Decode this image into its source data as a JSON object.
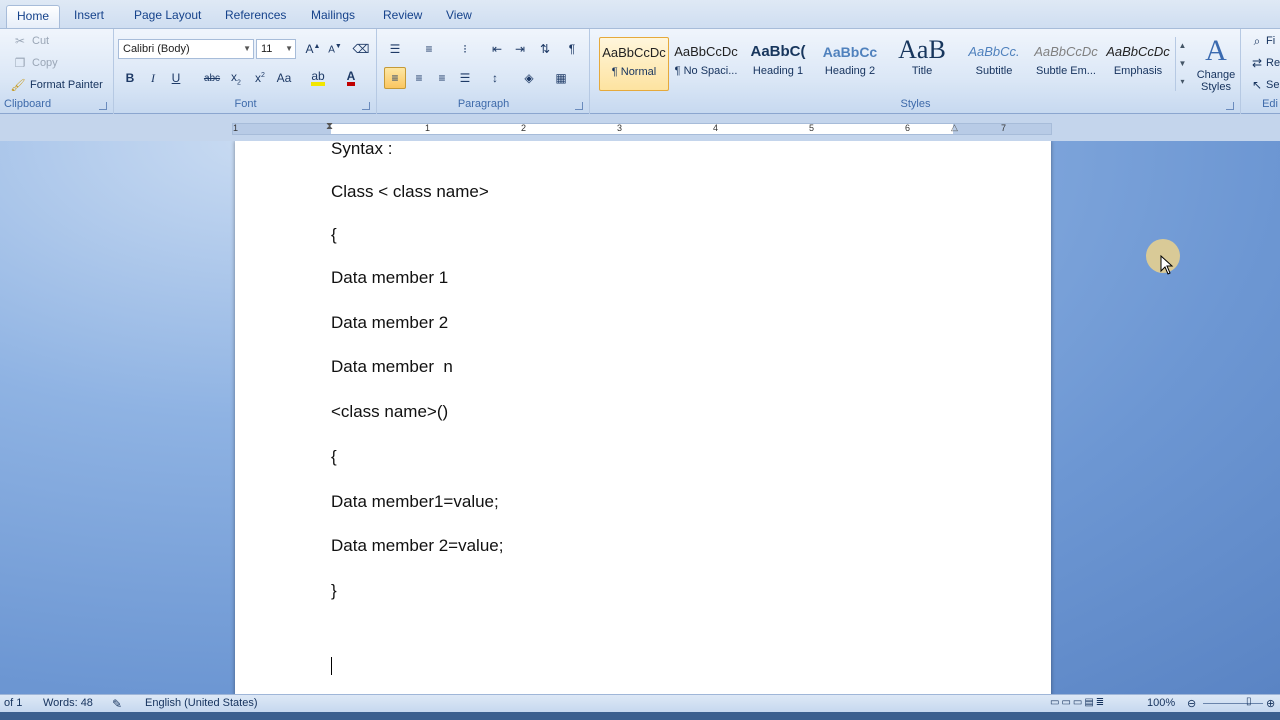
{
  "tabs": [
    "Home",
    "Insert",
    "Page Layout",
    "References",
    "Mailings",
    "Review",
    "View"
  ],
  "clipboard": {
    "cut": "Cut",
    "copy": "Copy",
    "format_painter": "Format Painter",
    "label": "Clipboard"
  },
  "font": {
    "family": "Calibri (Body)",
    "size": "11",
    "label": "Font"
  },
  "paragraph": {
    "label": "Paragraph"
  },
  "styles": {
    "label": "Styles",
    "items": [
      {
        "preview": "AaBbCcDc",
        "name": "¶ Normal"
      },
      {
        "preview": "AaBbCcDc",
        "name": "¶ No Spaci..."
      },
      {
        "preview": "AaBbC(",
        "name": "Heading 1"
      },
      {
        "preview": "AaBbCc",
        "name": "Heading 2"
      },
      {
        "preview": "AaB",
        "name": "Title"
      },
      {
        "preview": "AaBbCc.",
        "name": "Subtitle"
      },
      {
        "preview": "AaBbCcDc",
        "name": "Subtle Em..."
      },
      {
        "preview": "AaBbCcDc",
        "name": "Emphasis"
      }
    ],
    "change_styles": "Change Styles"
  },
  "editing": {
    "find": "Fi",
    "replace": "Re",
    "select": "Se",
    "label": "Edi"
  },
  "ruler_numbers": [
    "1",
    "1",
    "2",
    "3",
    "4",
    "5",
    "6",
    "7"
  ],
  "document": {
    "lines": [
      "Syntax :",
      "Class < class name>",
      "{",
      "Data member 1",
      "Data member 2",
      "Data member  n",
      "<class name>()",
      "{",
      "Data member1=value;",
      "Data member 2=value;",
      "}"
    ]
  },
  "status": {
    "page": "of 1",
    "words": "Words: 48",
    "language": "English (United States)",
    "zoom": "100%"
  }
}
